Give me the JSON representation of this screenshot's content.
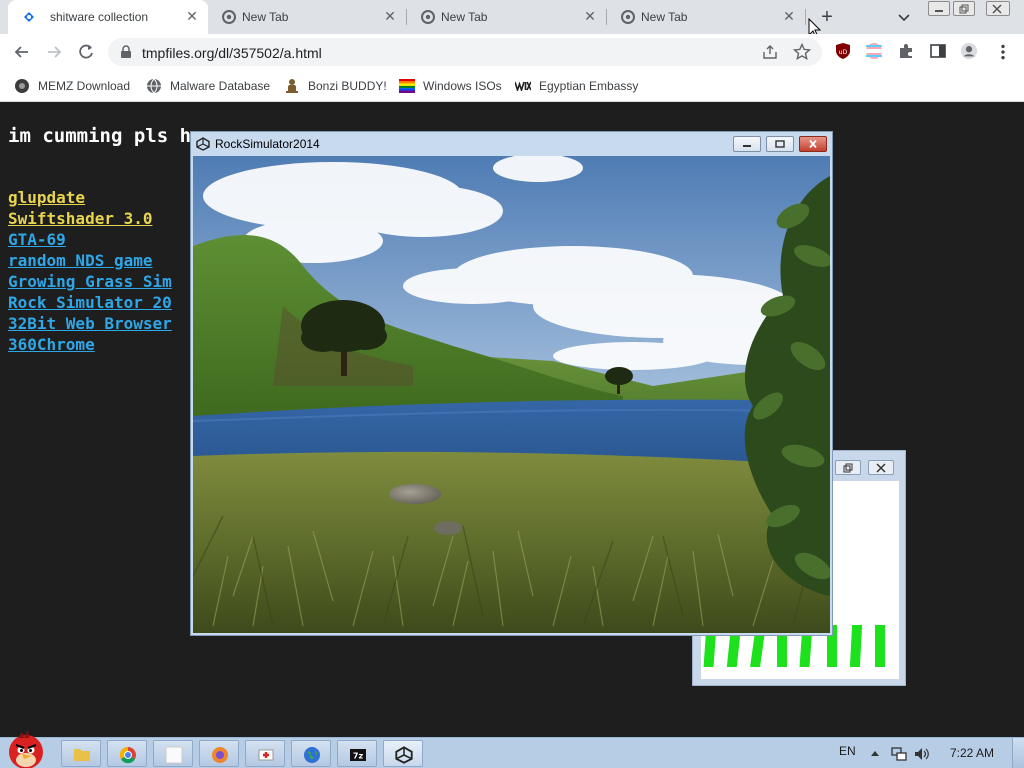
{
  "browser": {
    "tabs": [
      {
        "title": "shitware collection",
        "active": true
      },
      {
        "title": "New Tab",
        "active": false
      },
      {
        "title": "New Tab",
        "active": false
      },
      {
        "title": "New Tab",
        "active": false
      }
    ],
    "url": "tmpfiles.org/dl/357502/a.html",
    "bookmarks": [
      {
        "label": "MEMZ Download",
        "icon": "dark-circle-icon"
      },
      {
        "label": "Malware Database",
        "icon": "globe-icon"
      },
      {
        "label": "Bonzi BUDDY!",
        "icon": "purple-figure-icon"
      },
      {
        "label": "Windows ISOs",
        "icon": "rainbow-flag-icon"
      },
      {
        "label": "Egyptian Embassy",
        "icon": "wix-logo-icon"
      }
    ]
  },
  "page": {
    "heading": "im cumming pls h",
    "links": [
      {
        "text": "glupdate",
        "visited": true
      },
      {
        "text": "Swiftshader 3.0",
        "visited": true
      },
      {
        "text": "GTA-69",
        "visited": false
      },
      {
        "text": "random NDS game",
        "visited": false
      },
      {
        "text": "Growing Grass Sim",
        "visited": false
      },
      {
        "text": "Rock Simulator 20",
        "visited": false
      },
      {
        "text": "32Bit Web Browser",
        "visited": false
      },
      {
        "text": "360Chrome",
        "visited": false
      }
    ]
  },
  "game_window": {
    "title": "RockSimulator2014"
  },
  "taskbar": {
    "language": "EN",
    "time": "7:22 AM"
  },
  "colors": {
    "visited_link": "#e8d44d",
    "unvisited_link": "#2fa7e6",
    "page_bg": "#1e1e1e",
    "equalizer_bar": "#1ee11e"
  }
}
